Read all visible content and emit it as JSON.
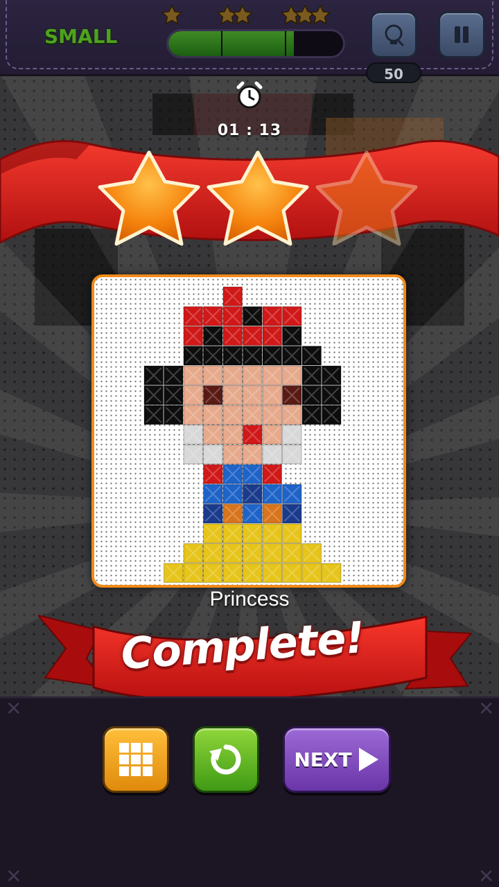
{
  "header": {
    "size_label": "SMALL",
    "progress_fraction": 0.72,
    "hint_count": "50",
    "hint_icon": "lightbulb-icon",
    "pause_icon": "pause-icon"
  },
  "timer": {
    "icon": "alarm-clock-icon",
    "value": "01 : 13"
  },
  "result": {
    "stars_earned": 2,
    "stars_total": 3,
    "puzzle_name": "Princess",
    "banner_text": "Complete!"
  },
  "actions": {
    "grid_icon": "level-grid-icon",
    "retry_icon": "retry-icon",
    "next_label": "NEXT",
    "next_icon": "play-arrow-icon"
  },
  "colors": {
    "accent_orange": "#f08a1a",
    "ribbon_red": "#d81b1b",
    "size_green": "#4fa21e"
  }
}
